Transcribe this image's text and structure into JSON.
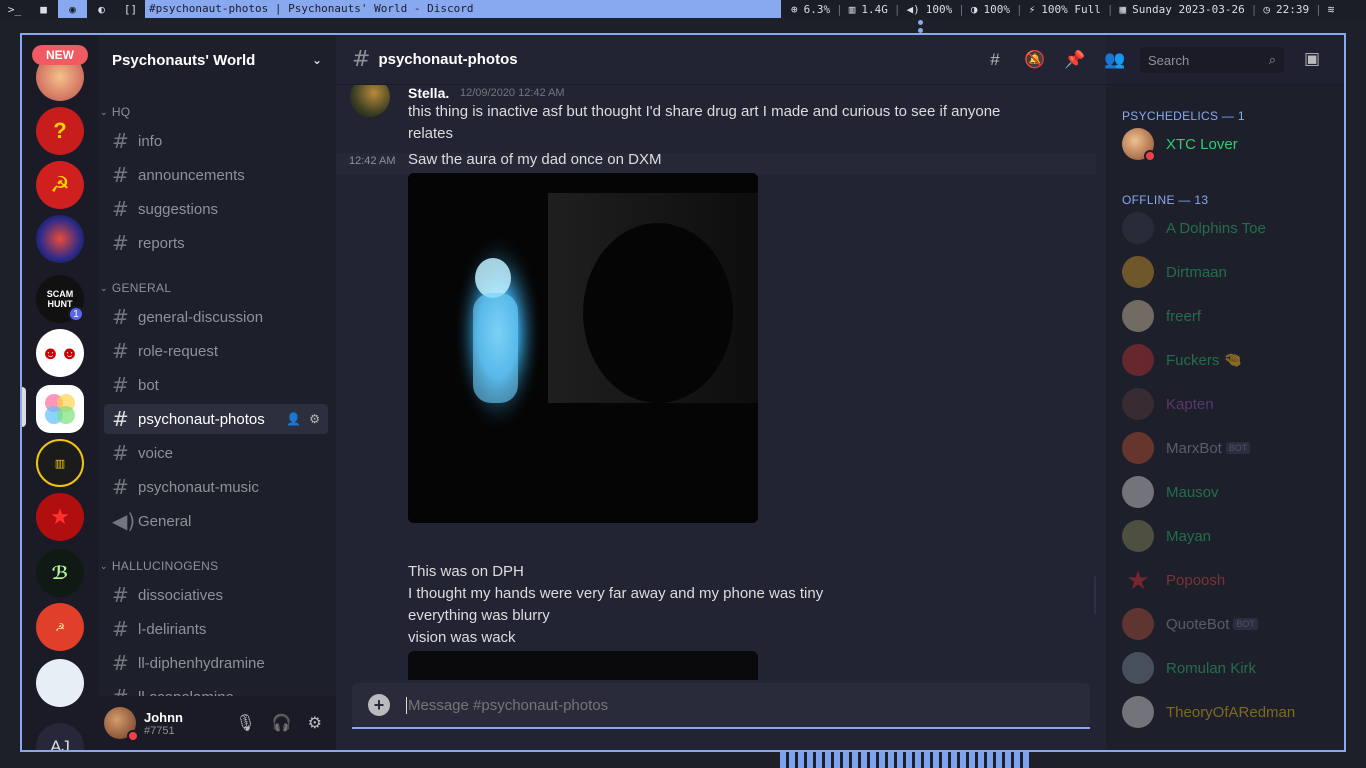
{
  "topbar": {
    "title": "#psychonaut-photos | Psychonauts' World - Discord",
    "cpu": "6.3%",
    "mem": "1.4G",
    "volume": "100%",
    "brightness": "100%",
    "battery": "100% Full",
    "date": "Sunday 2023-03-26",
    "time": "22:39"
  },
  "guilds": {
    "new_label": "NEW",
    "scam_badge": "1",
    "user_initials": "AJ",
    "scam_text": "SCAM HUNT"
  },
  "server": {
    "name": "Psychonauts' World",
    "categories": [
      "HQ",
      "GENERAL",
      "HALLUCINOGENS"
    ],
    "channels_hq": [
      "info",
      "announcements",
      "suggestions",
      "reports"
    ],
    "channels_general": [
      "general-discussion",
      "role-request",
      "bot",
      "psychonaut-photos",
      "voice",
      "psychonaut-music",
      "General"
    ],
    "channels_hallu": [
      "dissociatives",
      "l-deliriants",
      "ll-diphenhydramine",
      "ll-scopolamine"
    ]
  },
  "user": {
    "name": "Johnn",
    "tag": "#7751"
  },
  "chat": {
    "channel_name": "psychonaut-photos",
    "search_placeholder": "Search",
    "author": "Stella.",
    "timestamp": "12/09/2020 12:42 AM",
    "lines": [
      "this thing is inactive asf but thought I'd share drug art I made and curious to see if anyone",
      "relates",
      "Saw the aura of my dad once on DXM",
      "This was on DPH",
      "I thought my hands were very far away and my phone was tiny",
      "everything was blurry",
      "vision was wack"
    ],
    "hover_stamp": "12:42 AM",
    "composer_placeholder": "Message #psychonaut-photos"
  },
  "members": {
    "online_header": "PSYCHEDELICS — 1",
    "offline_header": "OFFLINE — 13",
    "bot_tag": "BOT",
    "online": [
      {
        "name": "XTC Lover",
        "color": "#2ecc71"
      }
    ],
    "offline": [
      {
        "name": "A Dolphins Toe",
        "color": "#2ecc71"
      },
      {
        "name": "Dirtmaan",
        "color": "#2ecc71"
      },
      {
        "name": "freerf",
        "color": "#2ecc71"
      },
      {
        "name": "Fuckers 🤏",
        "color": "#2ecc71"
      },
      {
        "name": "Kapten",
        "color": "#9b59b6"
      },
      {
        "name": "MarxBot",
        "color": "#99aab5"
      },
      {
        "name": "Mausov",
        "color": "#2ecc71"
      },
      {
        "name": "Mayan",
        "color": "#2ecc71"
      },
      {
        "name": "Popoosh",
        "color": "#e74c3c"
      },
      {
        "name": "QuoteBot",
        "color": "#99aab5"
      },
      {
        "name": "Romulan Kirk",
        "color": "#2ecc71"
      },
      {
        "name": "TheoryOfARedman",
        "color": "#f1c40f"
      }
    ]
  }
}
